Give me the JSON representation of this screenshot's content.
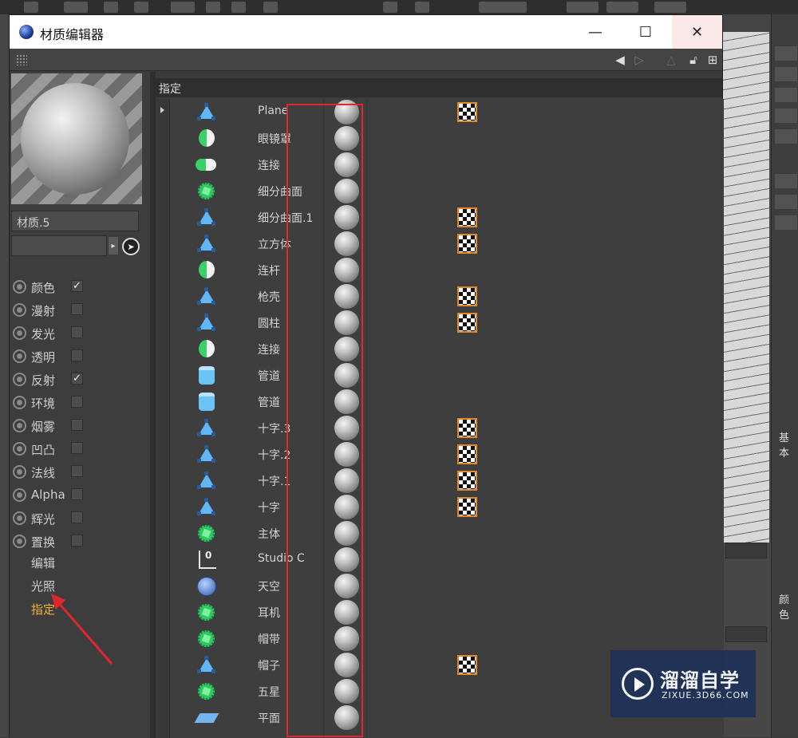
{
  "window": {
    "title": "材质编辑器",
    "controls": {
      "minimize": "—",
      "maximize": "☐",
      "close": "✕"
    }
  },
  "material": {
    "name": "材质.5"
  },
  "channels": [
    {
      "label": "颜色",
      "checked": true
    },
    {
      "label": "漫射",
      "checked": false
    },
    {
      "label": "发光",
      "checked": false
    },
    {
      "label": "透明",
      "checked": false
    },
    {
      "label": "反射",
      "checked": true
    },
    {
      "label": "环境",
      "checked": false
    },
    {
      "label": "烟雾",
      "checked": false
    },
    {
      "label": "凹凸",
      "checked": false
    },
    {
      "label": "法线",
      "checked": false
    },
    {
      "label": "Alpha",
      "checked": false
    },
    {
      "label": "辉光",
      "checked": false
    },
    {
      "label": "置换",
      "checked": false
    }
  ],
  "nav": [
    {
      "label": "编辑",
      "active": false
    },
    {
      "label": "光照",
      "active": false
    },
    {
      "label": "指定",
      "active": true
    }
  ],
  "assign": {
    "header": "指定",
    "rows": [
      {
        "name": "Plane",
        "icon": "polygon-object-icon",
        "uvw": true
      },
      {
        "name": "眼镜罩",
        "icon": "symmetry-icon",
        "uvw": false
      },
      {
        "name": "连接",
        "icon": "connect-icon",
        "uvw": false
      },
      {
        "name": "细分曲面",
        "icon": "subdivision-surface-icon",
        "uvw": false
      },
      {
        "name": "细分曲面.1",
        "icon": "polygon-object-icon",
        "uvw": true
      },
      {
        "name": "立方体",
        "icon": "polygon-object-icon",
        "uvw": true
      },
      {
        "name": "连杆",
        "icon": "symmetry-icon",
        "uvw": false
      },
      {
        "name": "枪壳",
        "icon": "polygon-object-icon",
        "uvw": true
      },
      {
        "name": "圆柱",
        "icon": "polygon-object-icon",
        "uvw": true
      },
      {
        "name": "连接",
        "icon": "symmetry-icon",
        "uvw": false
      },
      {
        "name": "管道",
        "icon": "tube-icon",
        "uvw": false
      },
      {
        "name": "管道",
        "icon": "tube-icon",
        "uvw": false
      },
      {
        "name": "十字.3",
        "icon": "polygon-object-icon",
        "uvw": true
      },
      {
        "name": "十字.2",
        "icon": "polygon-object-icon",
        "uvw": true
      },
      {
        "name": "十字.1",
        "icon": "polygon-object-icon",
        "uvw": true
      },
      {
        "name": "十字",
        "icon": "polygon-object-icon",
        "uvw": true
      },
      {
        "name": "主体",
        "icon": "subdivision-surface-icon",
        "uvw": false
      },
      {
        "name": "Studio C",
        "icon": "studio-null-icon",
        "uvw": false
      },
      {
        "name": "天空",
        "icon": "sky-icon",
        "uvw": false
      },
      {
        "name": "耳机",
        "icon": "subdivision-surface-icon",
        "uvw": false
      },
      {
        "name": "帽带",
        "icon": "subdivision-surface-icon",
        "uvw": false
      },
      {
        "name": "帽子",
        "icon": "polygon-object-icon",
        "uvw": true
      },
      {
        "name": "五星",
        "icon": "subdivision-surface-icon",
        "uvw": false
      },
      {
        "name": "平面",
        "icon": "plane-icon",
        "uvw": false
      }
    ]
  },
  "background": {
    "panel_labels": [
      "基本",
      "颜色"
    ]
  },
  "watermark": {
    "name": "溜溜自学",
    "url": "ZIXUE.3D66.COM"
  },
  "colors": {
    "accent_active": "#f1b33c",
    "annotation_red": "#e0272b",
    "uvw_border": "#e2892c"
  }
}
